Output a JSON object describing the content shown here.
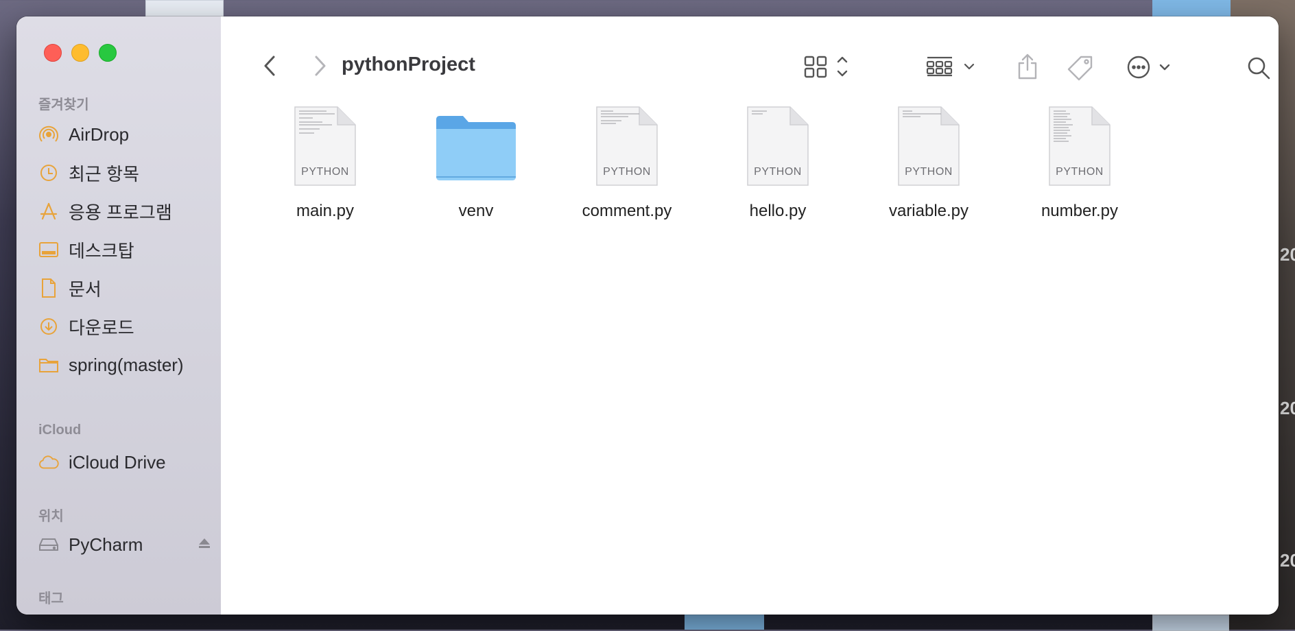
{
  "window": {
    "title": "pythonProject"
  },
  "sidebar": {
    "favorites_title": "즐겨찾기",
    "favorites": [
      {
        "label": "AirDrop",
        "icon": "airdrop-icon"
      },
      {
        "label": "최근 항목",
        "icon": "clock-icon"
      },
      {
        "label": "응용 프로그램",
        "icon": "applications-icon"
      },
      {
        "label": "데스크탑",
        "icon": "desktop-icon"
      },
      {
        "label": "문서",
        "icon": "document-icon"
      },
      {
        "label": "다운로드",
        "icon": "download-icon"
      },
      {
        "label": "spring(master)",
        "icon": "folder-icon"
      }
    ],
    "icloud_title": "iCloud",
    "icloud": [
      {
        "label": "iCloud Drive",
        "icon": "cloud-icon"
      }
    ],
    "locations_title": "위치",
    "locations": [
      {
        "label": "PyCharm",
        "icon": "drive-icon"
      }
    ],
    "tags_title": "태그"
  },
  "toolbar": {
    "back_icon": "chevron-left-icon",
    "forward_icon": "chevron-right-icon",
    "view_icon": "grid-view-icon",
    "group_icon": "group-icon",
    "share_icon": "share-icon",
    "tag_icon": "tag-icon",
    "more_icon": "ellipsis-circle-icon",
    "search_icon": "search-icon"
  },
  "files": [
    {
      "name": "main.py",
      "kind": "PYTHON",
      "type": "document"
    },
    {
      "name": "venv",
      "kind": "",
      "type": "folder"
    },
    {
      "name": "comment.py",
      "kind": "PYTHON",
      "type": "document"
    },
    {
      "name": "hello.py",
      "kind": "PYTHON",
      "type": "document"
    },
    {
      "name": "variable.py",
      "kind": "PYTHON",
      "type": "document"
    },
    {
      "name": "number.py",
      "kind": "PYTHON",
      "type": "document"
    }
  ],
  "colors": {
    "accent": "#e8a33a",
    "folder": "#79c0f3",
    "close": "#fe5f57",
    "minimize": "#febc2e",
    "zoom": "#28c840"
  }
}
